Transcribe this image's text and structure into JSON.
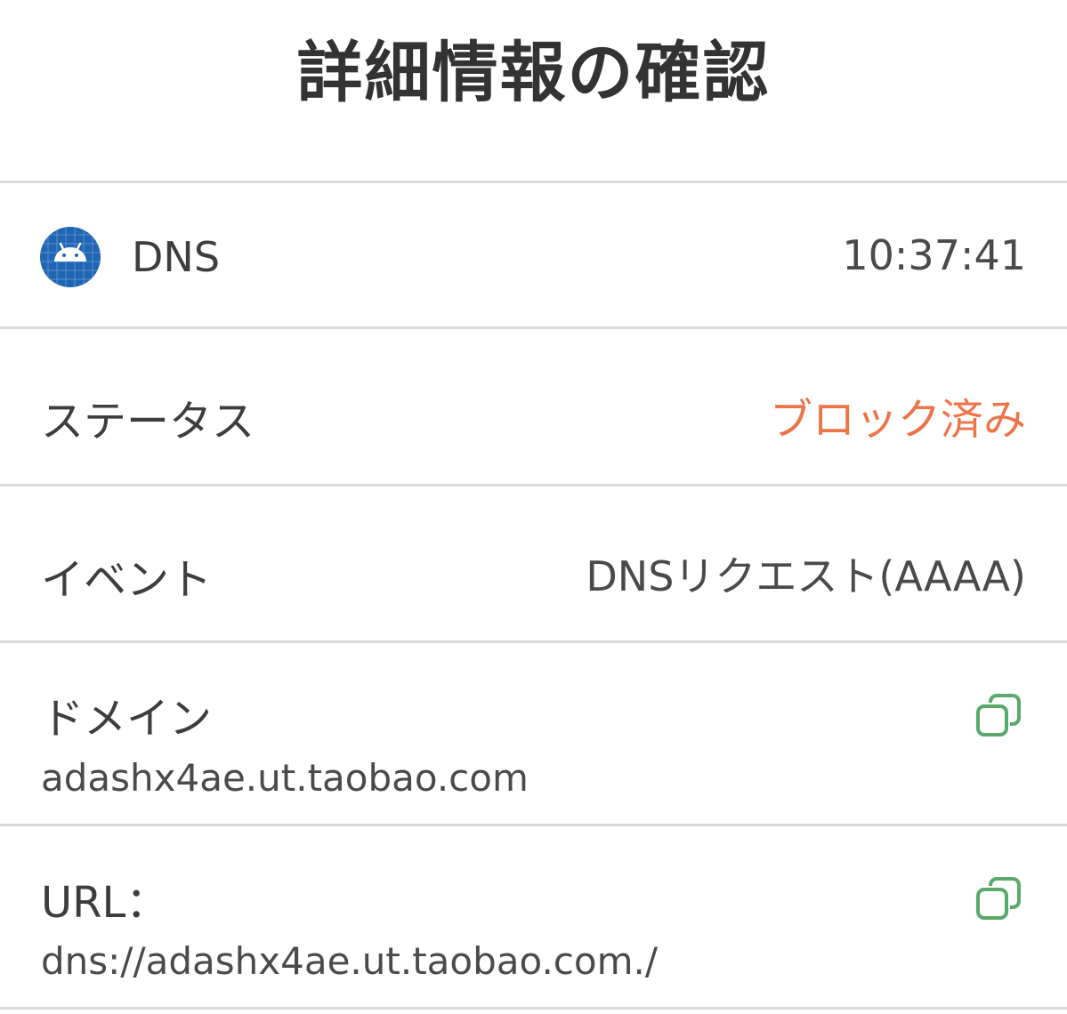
{
  "page": {
    "title": "詳細情報の確認"
  },
  "app": {
    "icon": "android-app-icon",
    "name": "DNS",
    "time": "10:37:41"
  },
  "status": {
    "label": "ステータス",
    "value": "ブロック済み",
    "value_color": "#ec7447"
  },
  "event": {
    "label": "イベント",
    "value": "DNSリクエスト(AAAA)"
  },
  "domain": {
    "label": "ドメイン",
    "value": "adashx4ae.ut.taobao.com",
    "copy_icon": "copy-icon"
  },
  "url": {
    "label": "URL：",
    "value": "dns://adashx4ae.ut.taobao.com./",
    "copy_icon": "copy-icon"
  },
  "colors": {
    "accent_copy": "#5aa86a",
    "icon_bg": "#1f66b3"
  }
}
